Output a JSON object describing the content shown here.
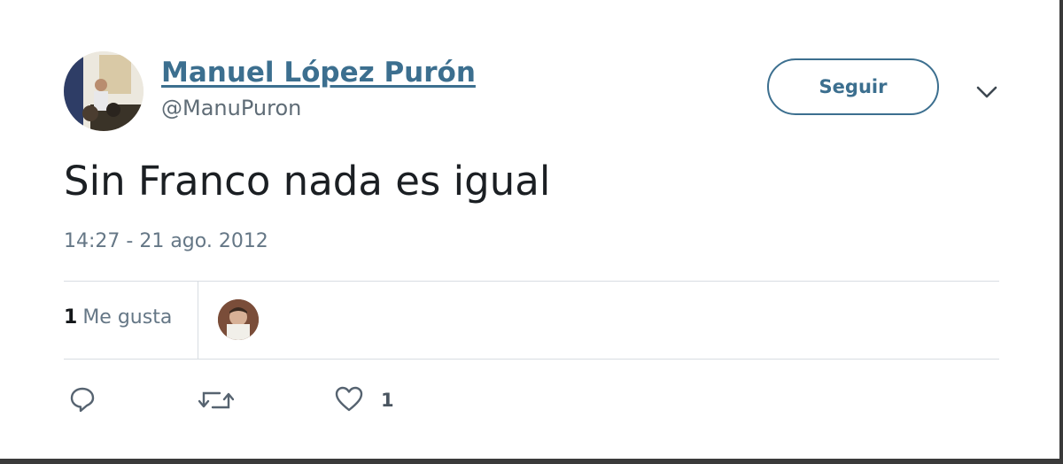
{
  "tweet": {
    "author": {
      "display_name": "Manuel López Purón",
      "handle": "@ManuPuron",
      "avatar_icon": "profile-photo"
    },
    "follow_button_label": "Seguir",
    "menu_icon": "chevron-down-icon",
    "text": "Sin Franco nada es igual",
    "timestamp": "14:27 - 21 ago. 2012",
    "stats": {
      "likes_count": "1",
      "likes_label": "Me gusta"
    },
    "actions": {
      "reply_icon": "reply-icon",
      "retweet_icon": "retweet-icon",
      "like_icon": "heart-icon",
      "like_count": "1"
    }
  },
  "colors": {
    "link": "#3c6f8f",
    "muted": "#657786",
    "divider": "#d8dde2"
  }
}
